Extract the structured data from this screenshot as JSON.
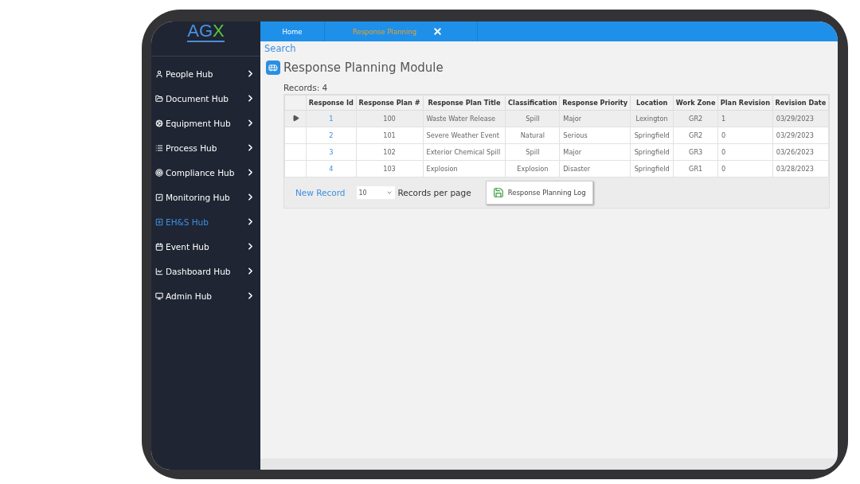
{
  "logo": {
    "text_1": "AG",
    "text_2": "X"
  },
  "sidebar": {
    "items": [
      {
        "label": "People Hub",
        "selected": false
      },
      {
        "label": "Document Hub",
        "selected": false
      },
      {
        "label": "Equipment Hub",
        "selected": false
      },
      {
        "label": "Process Hub",
        "selected": false
      },
      {
        "label": "Compliance Hub",
        "selected": false
      },
      {
        "label": "Monitoring Hub",
        "selected": false
      },
      {
        "label": "EH&S Hub",
        "selected": true
      },
      {
        "label": "Event Hub",
        "selected": false
      },
      {
        "label": "Dashboard Hub",
        "selected": false
      },
      {
        "label": "Admin Hub",
        "selected": false
      }
    ]
  },
  "tabs": [
    {
      "label": "Home",
      "selected": false,
      "closable": false
    },
    {
      "label": "Response Planning",
      "selected": true,
      "closable": true
    }
  ],
  "search_link": "Search",
  "page_title": "Response Planning Module",
  "records_count": "Records:  4",
  "table": {
    "columns": [
      "Response Id",
      "Response Plan #",
      "Response Plan Title",
      "Classification",
      "Response Priority",
      "Location",
      "Work Zone",
      "Plan Revision",
      "Revision Date"
    ],
    "rows": [
      {
        "selected": true,
        "cells": [
          "1",
          "100",
          "Waste Water Release",
          "Spill",
          "Major",
          "Lexington",
          "GR2",
          "1",
          "03/29/2023"
        ]
      },
      {
        "selected": false,
        "cells": [
          "2",
          "101",
          "Severe Weather Event",
          "Natural",
          "Serious",
          "Springfield",
          "GR2",
          "0",
          "03/29/2023"
        ]
      },
      {
        "selected": false,
        "cells": [
          "3",
          "102",
          "Exterior Chemical Spill",
          "Spill",
          "Major",
          "Springfield",
          "GR3",
          "0",
          "03/26/2023"
        ]
      },
      {
        "selected": false,
        "cells": [
          "4",
          "103",
          "Explosion",
          "Explosion",
          "Disaster",
          "Springfield",
          "GR1",
          "0",
          "03/28/2023"
        ]
      }
    ]
  },
  "footer": {
    "new_record": "New Record",
    "page_size": "10",
    "per_page_label": "Records per page",
    "log_button": "Response Planning Log"
  }
}
